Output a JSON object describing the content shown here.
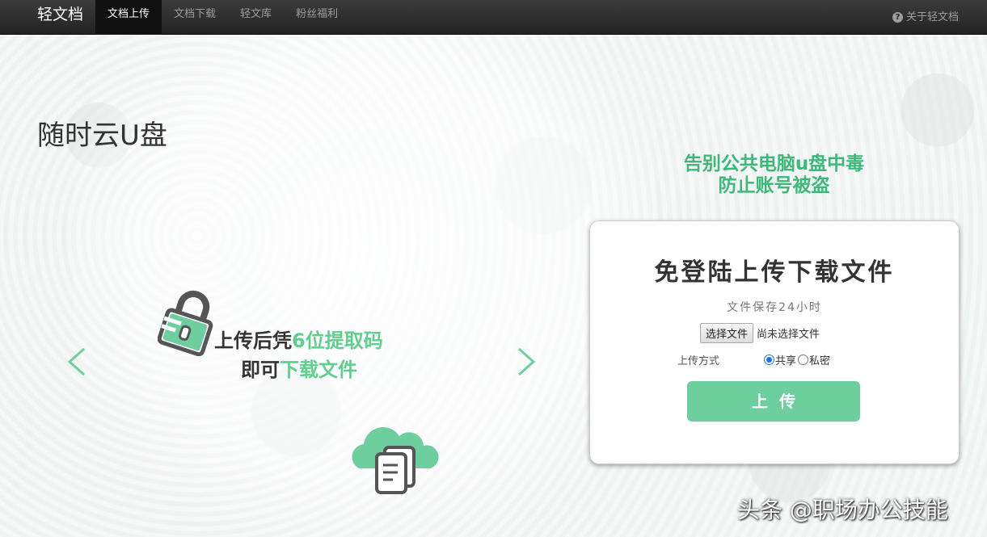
{
  "navbar": {
    "brand": "轻文档",
    "items": [
      "文档上传",
      "文档下载",
      "轻文库",
      "粉丝福利"
    ],
    "active_index": 0,
    "about": "关于轻文档"
  },
  "page_title": "随时云U盘",
  "carousel": {
    "line1_prefix": "上传后凭",
    "line1_highlight": "6位提取码",
    "line2_prefix": "即可",
    "line2_highlight": "下载文件"
  },
  "slogan": {
    "line1": "告别公共电脑u盘中毒",
    "line2": "防止账号被盗"
  },
  "upload_card": {
    "title": "免登陆上传下载文件",
    "subtitle": "文件保存24小时",
    "choose_file_label": "选择文件",
    "no_file_text": "尚未选择文件",
    "mode_label": "上传方式",
    "mode_options": [
      "共享",
      "私密"
    ],
    "mode_selected": "共享",
    "upload_label": "上传"
  },
  "watermark": "头条 @职场办公技能",
  "colors": {
    "accent_green": "#5fcf8e",
    "button_green": "#6ccf9d",
    "navbar": "#222222"
  }
}
